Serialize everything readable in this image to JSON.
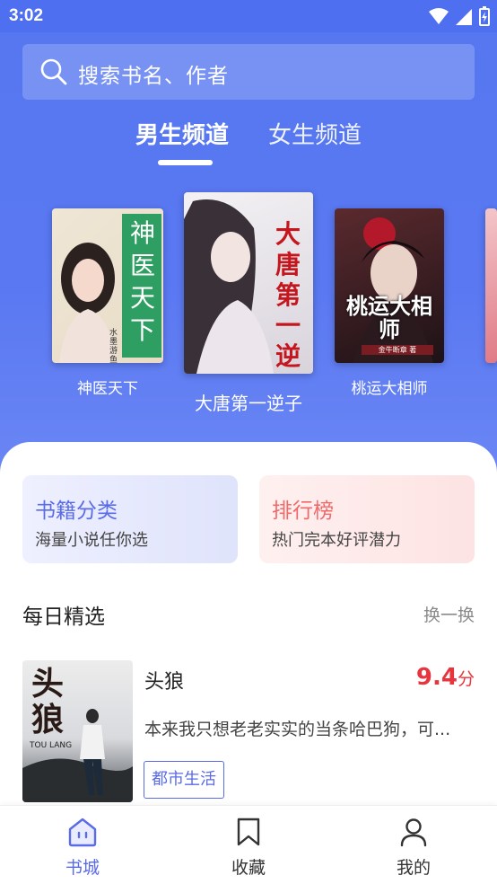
{
  "status_bar": {
    "time": "3:02"
  },
  "search": {
    "placeholder": "搜索书名、作者"
  },
  "channels": {
    "tabs": [
      {
        "label": "男生频道",
        "active": true
      },
      {
        "label": "女生频道",
        "active": false
      }
    ]
  },
  "carousel": {
    "books": [
      {
        "title": "神医天下",
        "cover_text": "神医天下",
        "cover_author": "水墨游鱼 著"
      },
      {
        "title": "大唐第一逆子",
        "cover_text": "大唐第一逆子"
      },
      {
        "title": "桃运大相师",
        "cover_text": "桃运大相师",
        "cover_author": "金牛断章 著"
      }
    ]
  },
  "cards": [
    {
      "title": "书籍分类",
      "subtitle": "海量小说任你选"
    },
    {
      "title": "排行榜",
      "subtitle": "热门完本好评潜力"
    }
  ],
  "daily": {
    "title": "每日精选",
    "refresh_label": "换一换",
    "book": {
      "title": "头狼",
      "score": "9.4",
      "score_unit": "分",
      "description": "本来我只想老老实实的当条哈巴狗，可...",
      "tag": "都市生活",
      "cover_text": "头狼",
      "cover_subtext": "TOU LANG"
    }
  },
  "bottom_nav": [
    {
      "label": "书城",
      "active": true
    },
    {
      "label": "收藏",
      "active": false
    },
    {
      "label": "我的",
      "active": false
    }
  ],
  "colors": {
    "primary": "#5a6be8",
    "hero": "#5577f0",
    "score": "#e8343c"
  }
}
